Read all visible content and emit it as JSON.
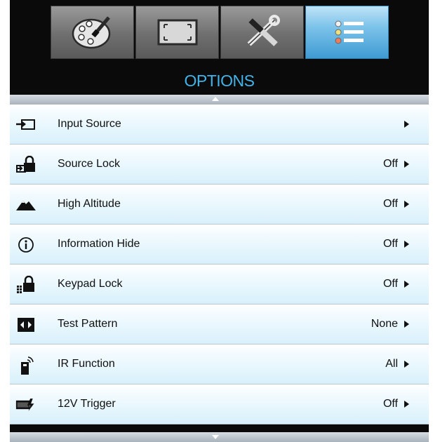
{
  "tabs": [
    {
      "icon": "palette-icon",
      "active": false
    },
    {
      "icon": "display-frame-icon",
      "active": false
    },
    {
      "icon": "tools-icon",
      "active": false
    },
    {
      "icon": "options-list-icon",
      "active": true
    }
  ],
  "header": {
    "title": "OPTIONS"
  },
  "menu": {
    "items": [
      {
        "icon": "input-source-icon",
        "label": "Input Source",
        "value": ""
      },
      {
        "icon": "source-lock-icon",
        "label": "Source Lock",
        "value": "Off"
      },
      {
        "icon": "high-altitude-icon",
        "label": "High Altitude",
        "value": "Off"
      },
      {
        "icon": "info-icon",
        "label": "Information Hide",
        "value": "Off"
      },
      {
        "icon": "keypad-lock-icon",
        "label": "Keypad Lock",
        "value": "Off"
      },
      {
        "icon": "test-pattern-icon",
        "label": "Test Pattern",
        "value": "None"
      },
      {
        "icon": "ir-function-icon",
        "label": "IR Function",
        "value": "All"
      },
      {
        "icon": "12v-trigger-icon",
        "label": "12V Trigger",
        "value": "Off"
      }
    ]
  },
  "colors": {
    "title": "#42b3e8",
    "active_tab": "#5fb2e2",
    "row_gradient_end": "#d8f0fb"
  }
}
